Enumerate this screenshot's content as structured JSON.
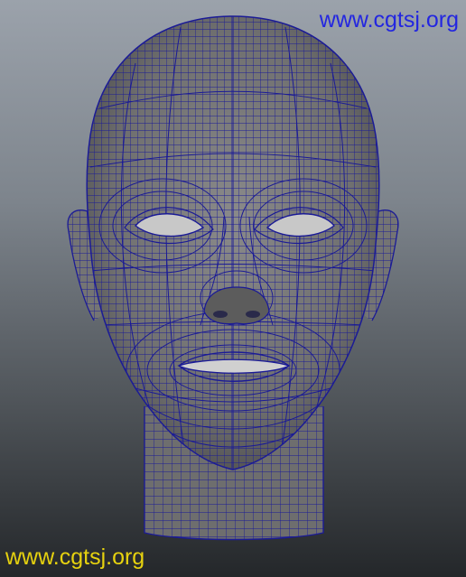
{
  "viewport": {
    "colors": {
      "background_top": "#9ba2ab",
      "background_bottom": "#24272a",
      "mesh_fill": "#7a7a7a",
      "wire": "#1b1b96"
    },
    "model_icon": "wireframe-head"
  },
  "watermarks": {
    "top": {
      "text": "www.cgtsj.org",
      "color": "#2326e0"
    },
    "bottom": {
      "text": "www.cgtsj.org",
      "color": "#e6d20f"
    }
  }
}
